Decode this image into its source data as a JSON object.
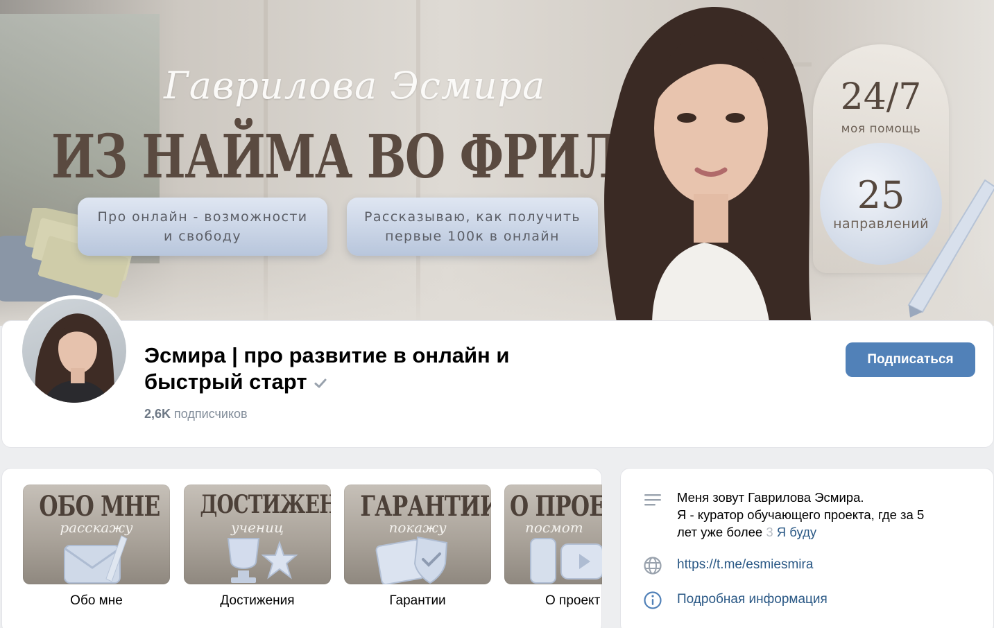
{
  "cover": {
    "script_name": "Гаврилова Эсмира",
    "headline": "ИЗ НАЙМА ВО ФРИЛАНС",
    "pill_left": "Про онлайн - возможности\nи свободу",
    "pill_right": "Рассказываю, как получить\nпервые 100к в онлайн",
    "badge_top_value": "24/7",
    "badge_top_caption": "моя помощь",
    "badge_bottom_value": "25",
    "badge_bottom_caption": "направлений"
  },
  "profile": {
    "title": "Эсмира | про развитие в онлайн и быстрый старт",
    "subscribers_count": "2,6K",
    "subscribers_label": "подписчиков",
    "subscribe_label": "Подписаться"
  },
  "articles": [
    {
      "thumb_title": "ОБО МНЕ",
      "thumb_script": "расскажу",
      "label": "Обо мне",
      "icon": "envelope-icon"
    },
    {
      "thumb_title": "ДОСТИЖЕНИЯ",
      "thumb_script": "учениц",
      "label": "Достижения",
      "icon": "trophy-icon"
    },
    {
      "thumb_title": "ГАРАНТИИ",
      "thumb_script": "покажу",
      "label": "Гарантии",
      "icon": "shield-icon"
    },
    {
      "thumb_title": "О ПРОЕ",
      "thumb_script": "посмот",
      "label": "О проект",
      "icon": "phone-icon"
    }
  ],
  "info": {
    "description_line1": "Меня зовут Гаврилова Эсмира.",
    "description_line2": "Я - куратор обучающего проекта, где за 5",
    "description_line3": "лет уже более",
    "description_fade": "3",
    "description_more": "Я буду",
    "link_url": "https://t.me/esmiesmira",
    "details_label": "Подробная информация"
  },
  "colors": {
    "accent": "#5181b8",
    "link": "#2a5885",
    "muted": "#818c99",
    "page_bg": "#edeef0"
  }
}
